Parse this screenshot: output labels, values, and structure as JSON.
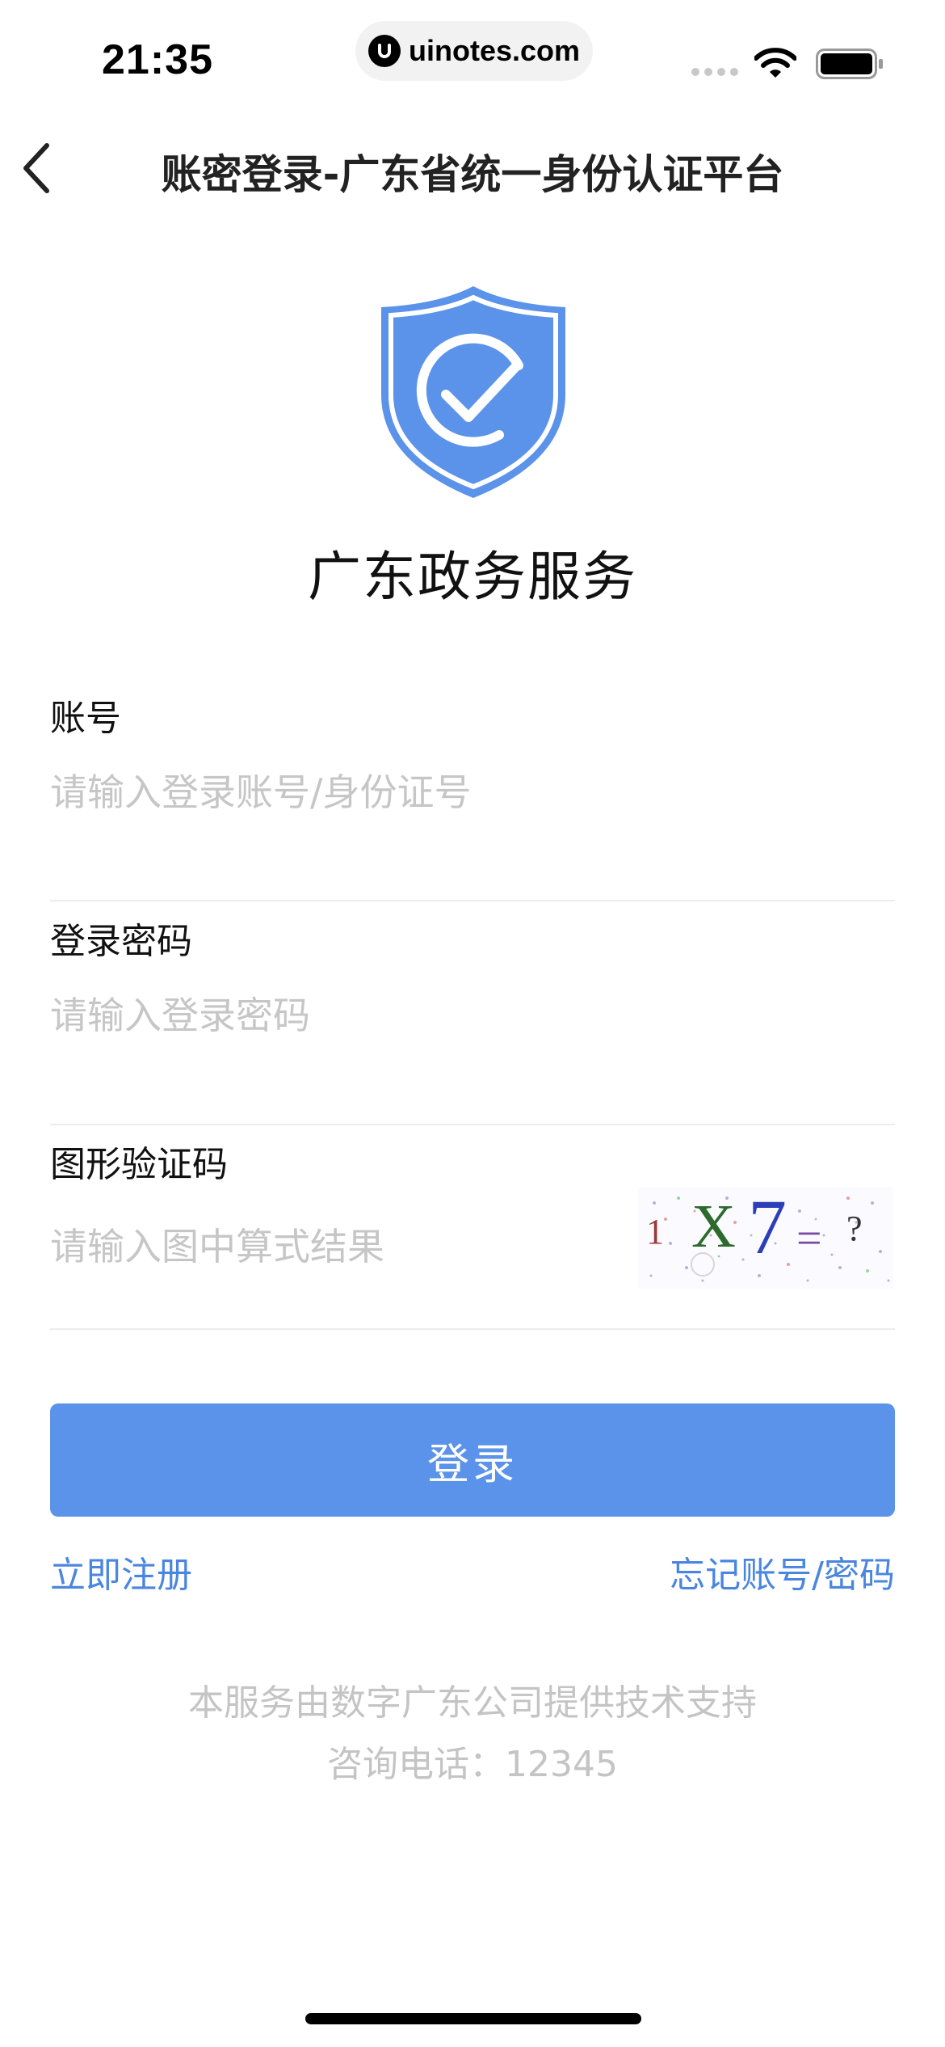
{
  "status_bar": {
    "time": "21:35",
    "url": "uinotes.com"
  },
  "nav": {
    "title": "账密登录-广东省统一身份认证平台",
    "back_icon": "chevron-left-icon"
  },
  "brand": {
    "icon": "shield-check-icon",
    "name": "广东政务服务",
    "accent_color": "#5a93e9"
  },
  "form": {
    "account": {
      "label": "账号",
      "placeholder": "请输入登录账号/身份证号",
      "value": ""
    },
    "password": {
      "label": "登录密码",
      "placeholder": "请输入登录密码",
      "value": ""
    },
    "captcha": {
      "label": "图形验证码",
      "placeholder": "请输入图中算式结果",
      "value": "",
      "image_text": "1 X 7 = ?"
    }
  },
  "actions": {
    "login_label": "登录",
    "register_label": "立即注册",
    "forgot_label": "忘记账号/密码"
  },
  "footer": {
    "support": "本服务由数字广东公司提供技术支持",
    "hotline": "咨询电话：12345"
  }
}
